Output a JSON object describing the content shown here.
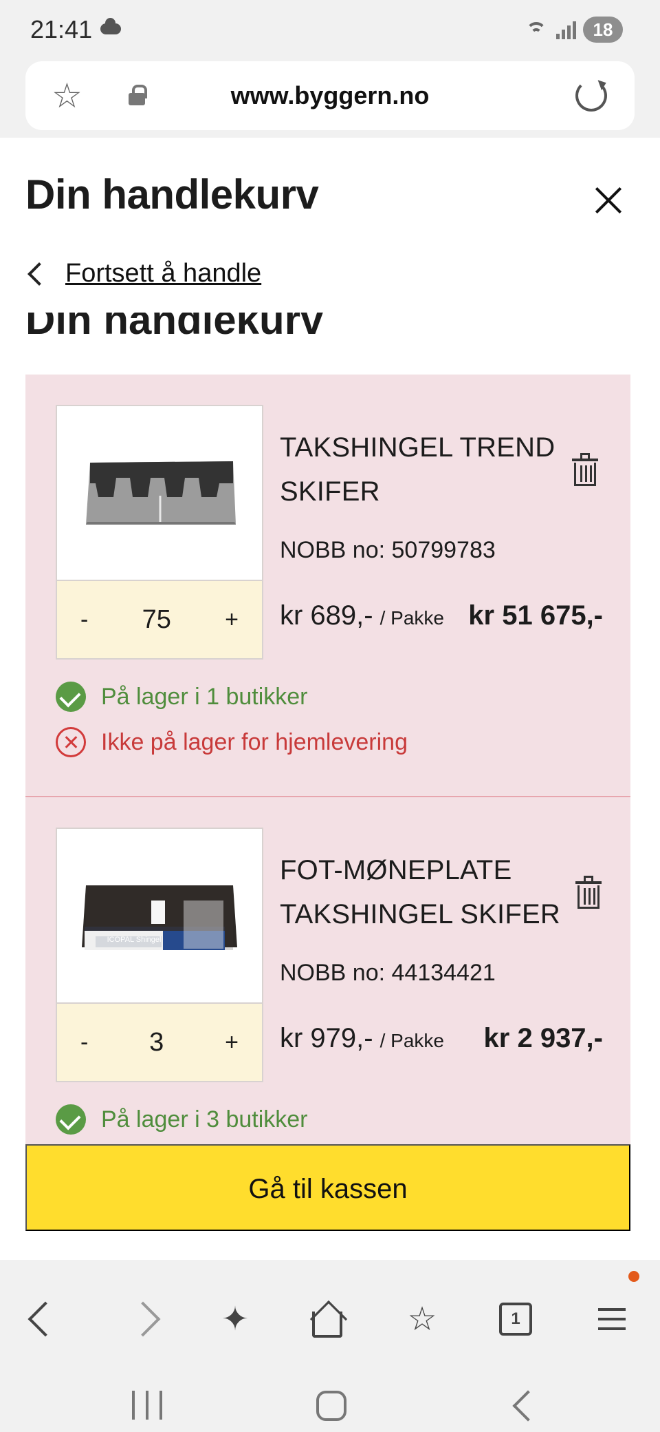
{
  "status_bar": {
    "time": "21:41",
    "battery": "18",
    "icons": [
      "cloud-icon",
      "wifi-icon",
      "signal-icon",
      "battery-icon"
    ]
  },
  "browser": {
    "url": "www.byggern.no",
    "icons": [
      "star-icon",
      "lock-icon",
      "reload-icon"
    ]
  },
  "cart": {
    "title": "Din handlekurv",
    "continue_link": "Fortsett å handle",
    "partial_heading": "Din handlekurv"
  },
  "items": [
    {
      "name": "TAKSHINGEL TREND SKIFER",
      "nobb": "NOBB no: 50799783",
      "quantity": "75",
      "minus": "-",
      "plus": "+",
      "unit_price": "kr 689,-",
      "unit": "/ Pakke",
      "total": "kr 51 675,-",
      "stock": [
        {
          "status": "ok",
          "text": "På lager i 1 butikker"
        },
        {
          "status": "no",
          "text": "Ikke på lager for hjemlevering"
        }
      ]
    },
    {
      "name": "FOT-MØNEPLATE TAKSHINGEL SKIFER",
      "nobb": "NOBB no: 44134421",
      "quantity": "3",
      "minus": "-",
      "plus": "+",
      "unit_price": "kr 979,-",
      "unit": "/ Pakke",
      "total": "kr 2 937,-",
      "stock": [
        {
          "status": "ok",
          "text": "På lager i 3 butikker"
        }
      ],
      "product_label": "ICOPAL Shingel"
    }
  ],
  "checkout": {
    "label": "Gå til kassen"
  },
  "bottom_nav": {
    "items": [
      "back-icon",
      "forward-icon",
      "sparkle-icon",
      "home-icon",
      "bookmarks-icon",
      "tabs-icon",
      "menu-icon"
    ],
    "tab_count": "1"
  },
  "colors": {
    "cart_bg": "#f3e0e4",
    "quantity_bg": "#fcf4d9",
    "checkout_bg": "#ffdd2d",
    "in_stock": "#4f8d3c",
    "out_of_stock": "#c83a3a"
  }
}
